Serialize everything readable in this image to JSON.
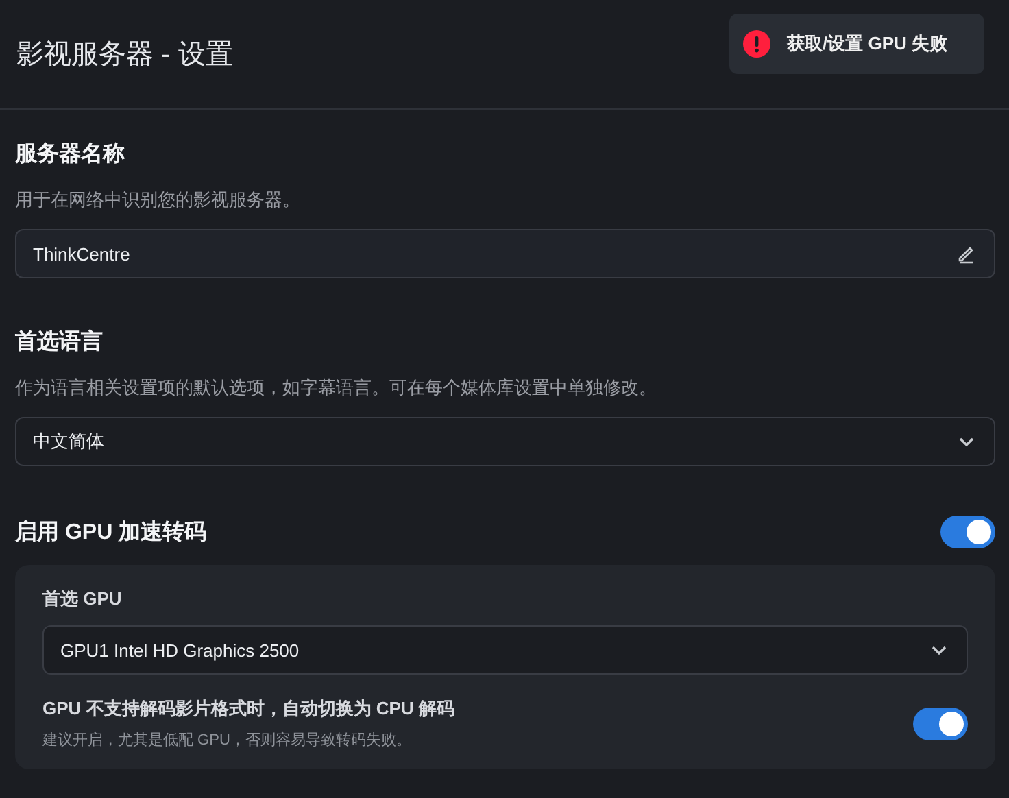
{
  "header": {
    "title": "影视服务器 - 设置"
  },
  "toast": {
    "message": "获取/设置 GPU 失败"
  },
  "sections": [
    {
      "kind": "text",
      "title": "服务器名称",
      "description": "用于在网络中识别您的影视服务器。",
      "value": "ThinkCentre"
    },
    {
      "kind": "select",
      "title": "首选语言",
      "description": "作为语言相关设置项的默认选项，如字幕语言。可在每个媒体库设置中单独修改。",
      "value": "中文简体"
    },
    {
      "kind": "toggle",
      "title": "启用 GPU 加速转码",
      "on": true,
      "options": [
        {
          "kind": "select",
          "label": "首选 GPU",
          "value": "GPU1 Intel HD Graphics 2500"
        },
        {
          "kind": "toggle",
          "label": "GPU 不支持解码影片格式时，自动切换为 CPU 解码",
          "hint": "建议开启，尤其是低配 GPU，否则容易导致转码失败。",
          "on": true
        }
      ]
    }
  ]
}
